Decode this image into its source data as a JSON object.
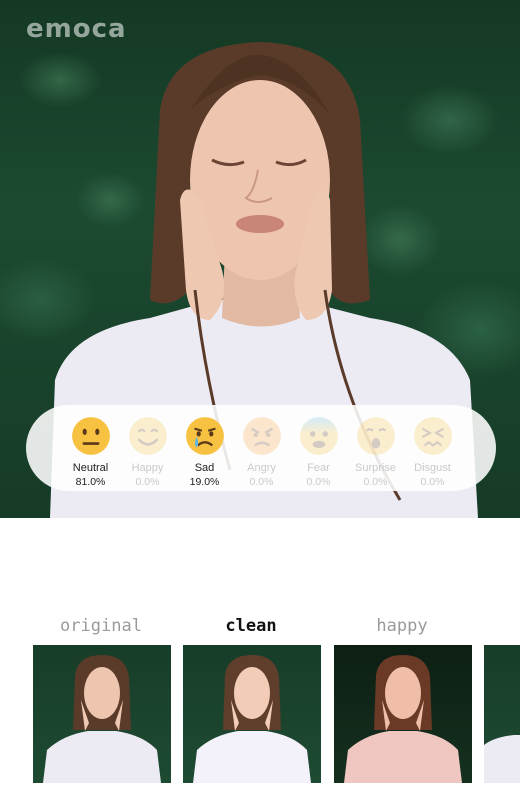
{
  "app": {
    "brand": "emoca"
  },
  "emotions": [
    {
      "name": "Neutral",
      "percent": "81.0%",
      "icon": "neutral-face-icon",
      "active": true
    },
    {
      "name": "Happy",
      "percent": "0.0%",
      "icon": "smiling-face-icon",
      "active": false
    },
    {
      "name": "Sad",
      "percent": "19.0%",
      "icon": "crying-face-icon",
      "active": true
    },
    {
      "name": "Angry",
      "percent": "0.0%",
      "icon": "angry-face-icon",
      "active": false
    },
    {
      "name": "Fear",
      "percent": "0.0%",
      "icon": "fearful-face-icon",
      "active": false
    },
    {
      "name": "Surprise",
      "percent": "0.0%",
      "icon": "surprised-face-icon",
      "active": false
    },
    {
      "name": "Disgust",
      "percent": "0.0%",
      "icon": "disgusted-face-icon",
      "active": false
    }
  ],
  "filters": [
    {
      "label": "original",
      "selected": false
    },
    {
      "label": "clean",
      "selected": true
    },
    {
      "label": "happy",
      "selected": false
    }
  ],
  "colors": {
    "emoji_yellow": "#f7c242",
    "tear_blue": "#5bb7e8",
    "foliage_green": "#1c4a30",
    "label_dim": "#9a9a9a"
  }
}
